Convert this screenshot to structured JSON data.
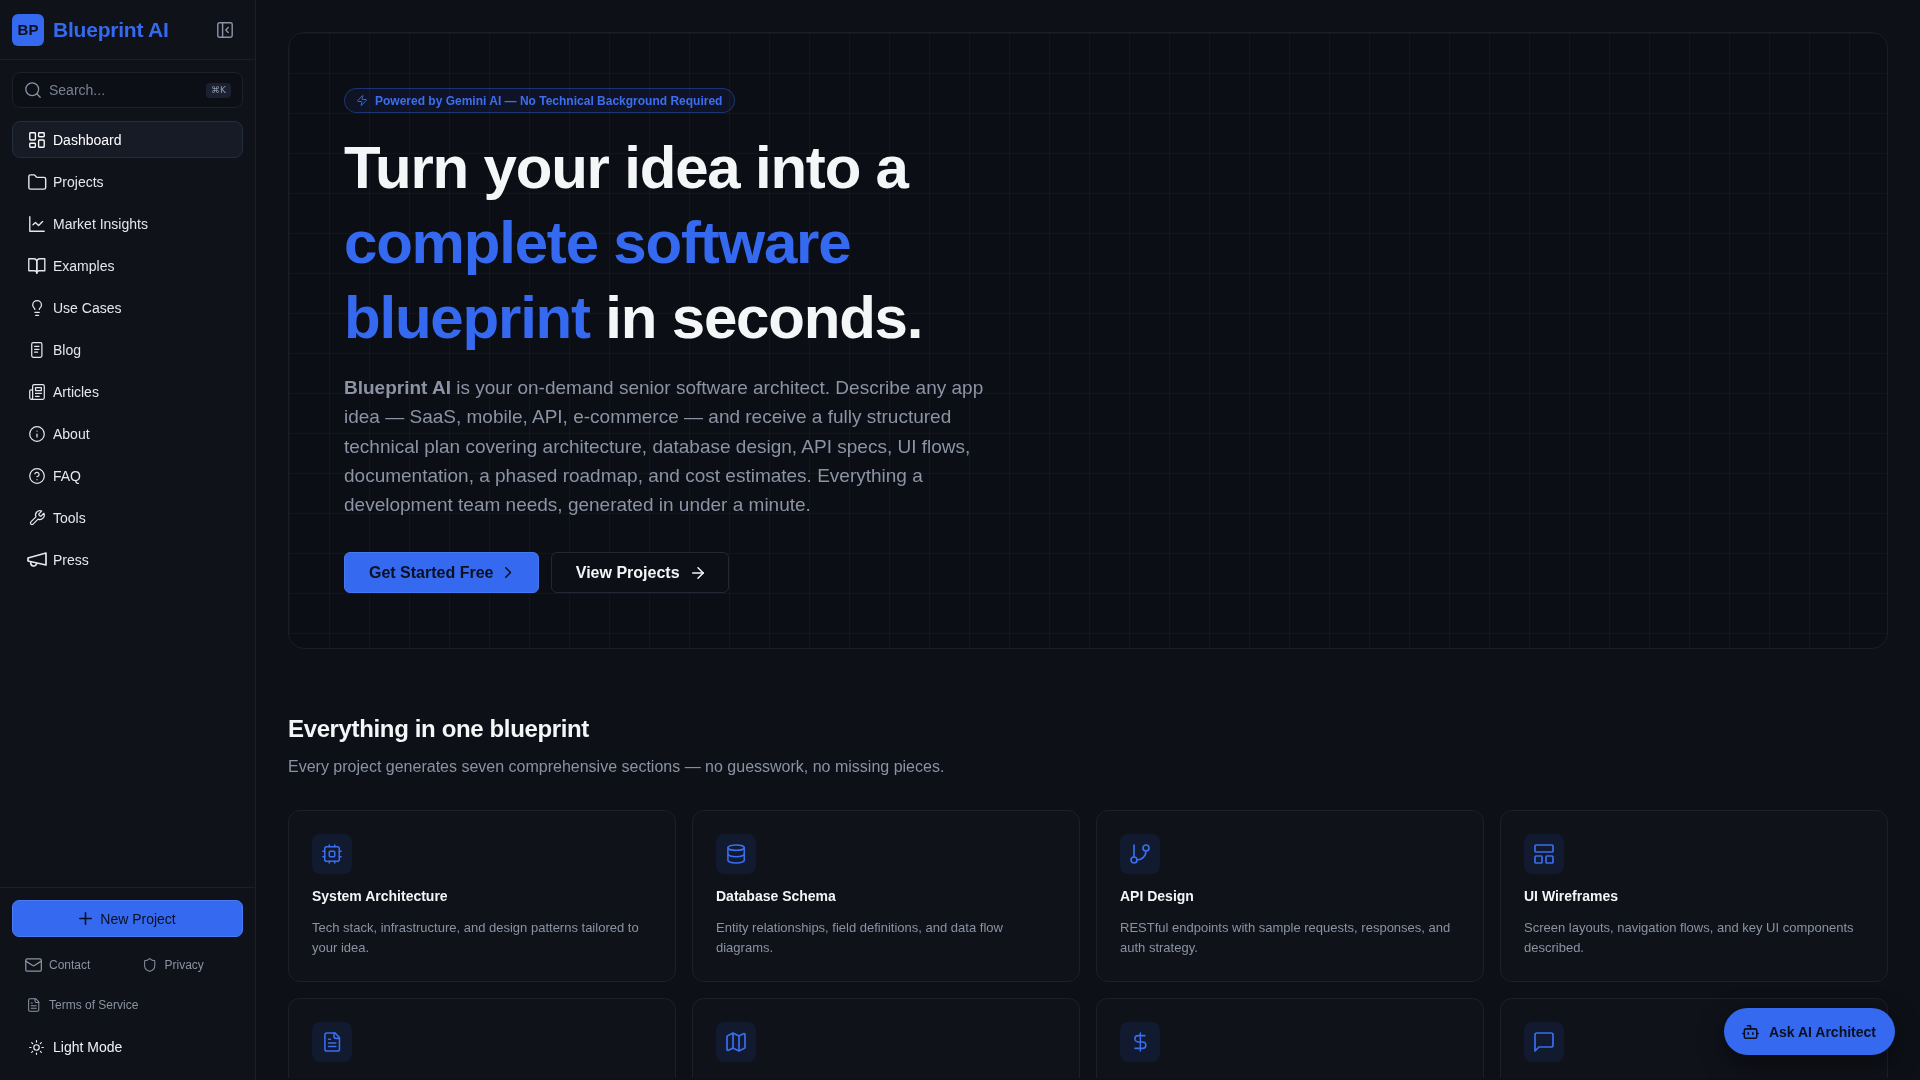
{
  "sidebar": {
    "logo_mark": "BP",
    "app_name": "Blueprint AI",
    "search": {
      "placeholder": "Search...",
      "shortcut": "⌘K"
    },
    "nav_items": [
      {
        "label": "Dashboard",
        "selected": true
      },
      {
        "label": "Projects",
        "selected": false
      },
      {
        "label": "Market Insights",
        "selected": false
      },
      {
        "label": "Examples",
        "selected": false
      },
      {
        "label": "Use Cases",
        "selected": false
      },
      {
        "label": "Blog",
        "selected": false
      },
      {
        "label": "Articles",
        "selected": false
      },
      {
        "label": "About",
        "selected": false
      },
      {
        "label": "FAQ",
        "selected": false
      },
      {
        "label": "Tools",
        "selected": false
      },
      {
        "label": "Press",
        "selected": false
      }
    ],
    "new_project_button": "New Project",
    "footer_links": [
      "Contact",
      "Privacy",
      "Terms of Service"
    ],
    "theme_toggle": "Light Mode"
  },
  "hero": {
    "badge": "Powered by Gemini AI — No Technical Background Required",
    "headline": [
      {
        "text": "Turn your idea into a",
        "accent": false
      },
      {
        "text": "complete software blueprint",
        "accent": true
      },
      {
        "text": "in seconds.",
        "accent": false
      }
    ],
    "description": "**Blueprint AI** is your on-demand senior software architect. Describe any app idea — SaaS, mobile, API, e-commerce — and receive a fully structured technical plan covering architecture, database design, API specs, UI flows, documentation, a phased roadmap, and cost estimates. Everything a development team needs, generated in under a minute.",
    "primary_button": "Get Started Free",
    "secondary_button": "View Projects"
  },
  "features": {
    "title": "Everything in one blueprint",
    "subtitle": "Every project generates seven comprehensive sections — no guesswork, no missing pieces.",
    "cards": [
      {
        "kind": "full",
        "title": "System Architecture",
        "description": "Tech stack, infrastructure, and design patterns tailored to your idea."
      },
      {
        "kind": "full",
        "title": "Database Schema",
        "description": "Entity relationships, field definitions, and data flow diagrams."
      },
      {
        "kind": "full",
        "title": "API Design",
        "description": "RESTful endpoints with sample requests, responses, and auth strategy."
      },
      {
        "kind": "full",
        "title": "UI Wireframes",
        "description": "Screen layouts, navigation flows, and key UI components described."
      },
      {
        "kind": "cut"
      },
      {
        "kind": "cut"
      },
      {
        "kind": "cut"
      },
      {
        "kind": "cut"
      }
    ]
  },
  "assistant_button": "Ask AI Architect"
}
